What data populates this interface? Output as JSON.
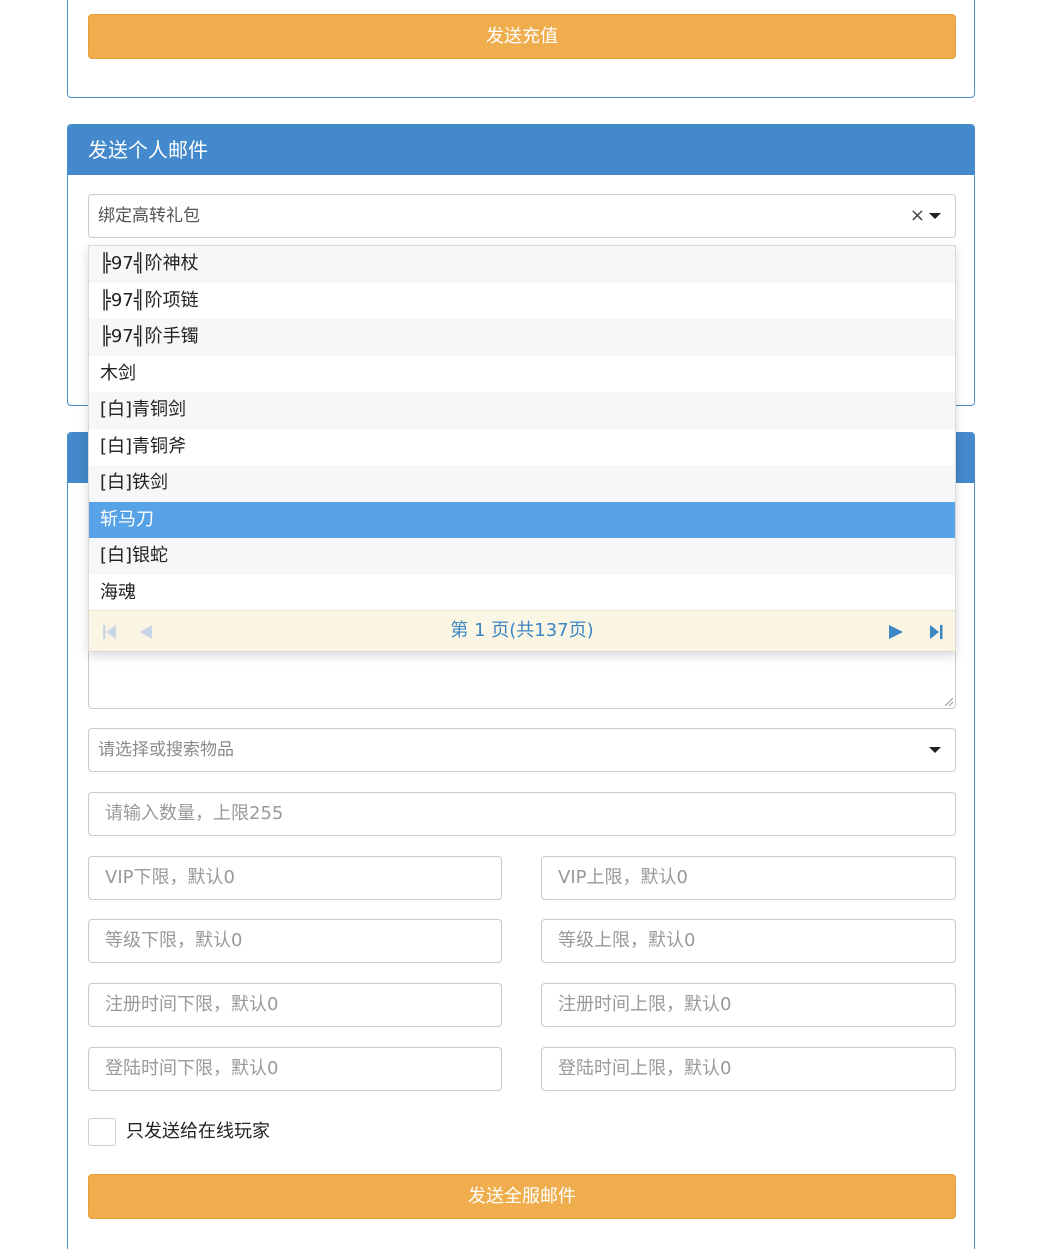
{
  "top_panel": {
    "send_recharge_label": "发送充值"
  },
  "personal_mail": {
    "title": "发送个人邮件",
    "selected_item": "绑定高转礼包",
    "clear_symbol": "×"
  },
  "dropdown": {
    "items": [
      "╠97╣阶神杖",
      "╠97╣阶项链",
      "╠97╣阶手镯",
      "木剑",
      "[白]青铜剑",
      "[白]青铜斧",
      "[白]铁剑",
      "斩马刀",
      "[白]银蛇",
      "海魂"
    ],
    "highlighted_index": 7,
    "pager_text": "第 1 页(共137页)",
    "colors": {
      "highlight": "#58a3e8",
      "pager_bg": "#fbf6e4",
      "pager_icon": "#3d86c6"
    }
  },
  "server_mail": {
    "item_select_placeholder": "请选择或搜索物品",
    "quantity_placeholder": "请输入数量，上限255",
    "vip_min_placeholder": "VIP下限，默认0",
    "vip_max_placeholder": "VIP上限，默认0",
    "level_min_placeholder": "等级下限，默认0",
    "level_max_placeholder": "等级上限，默认0",
    "reg_min_placeholder": "注册时间下限，默认0",
    "reg_max_placeholder": "注册时间上限，默认0",
    "login_min_placeholder": "登陆时间下限，默认0",
    "login_max_placeholder": "登陆时间上限，默认0",
    "online_only_label": "只发送给在线玩家",
    "send_all_label": "发送全服邮件"
  },
  "colors": {
    "panel_header": "#4389cb",
    "button_orange": "#efad4d"
  }
}
